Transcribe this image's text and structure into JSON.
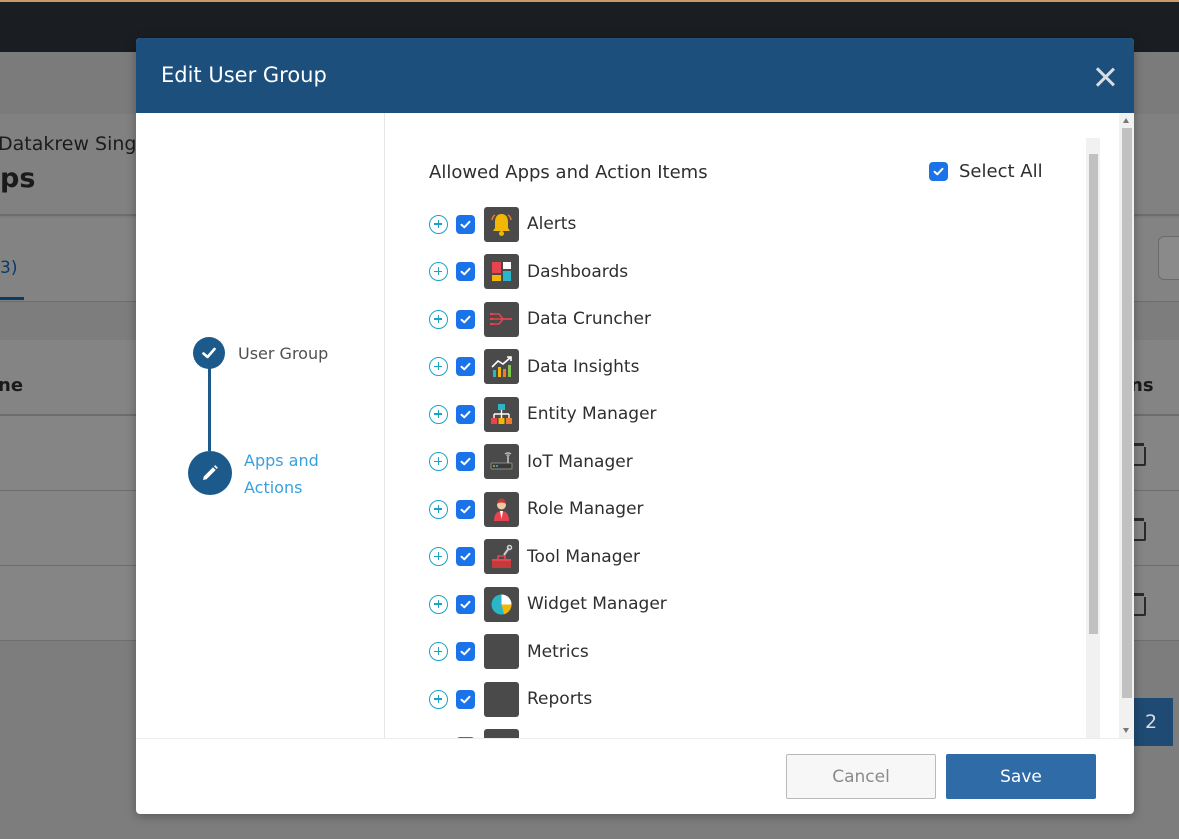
{
  "background": {
    "org_name": "Datakrew Singa",
    "page_title": "ps",
    "tab_count": "3)",
    "col_left": "ne",
    "col_right": "ns",
    "pagination_current": "2"
  },
  "modal": {
    "title": "Edit User Group",
    "close_icon": "close-icon"
  },
  "stepper": {
    "steps": [
      {
        "label": "User Group",
        "status": "completed"
      },
      {
        "label_line1": "Apps and",
        "label_line2": "Actions",
        "status": "active"
      }
    ]
  },
  "content": {
    "title": "Allowed Apps and Action Items",
    "select_all_label": "Select All",
    "select_all_checked": true,
    "apps": [
      {
        "label": "Alerts",
        "icon": "alerts-icon",
        "checked": true
      },
      {
        "label": "Dashboards",
        "icon": "dashboards-icon",
        "checked": true
      },
      {
        "label": "Data Cruncher",
        "icon": "data-cruncher-icon",
        "checked": true
      },
      {
        "label": "Data Insights",
        "icon": "data-insights-icon",
        "checked": true
      },
      {
        "label": "Entity Manager",
        "icon": "entity-manager-icon",
        "checked": true
      },
      {
        "label": "IoT Manager",
        "icon": "iot-manager-icon",
        "checked": true
      },
      {
        "label": "Role Manager",
        "icon": "role-manager-icon",
        "checked": true
      },
      {
        "label": "Tool Manager",
        "icon": "tool-manager-icon",
        "checked": true
      },
      {
        "label": "Widget Manager",
        "icon": "widget-manager-icon",
        "checked": true
      },
      {
        "label": "Metrics",
        "icon": "metrics-icon",
        "checked": true
      },
      {
        "label": "Reports",
        "icon": "reports-icon",
        "checked": true
      }
    ]
  },
  "footer": {
    "cancel_label": "Cancel",
    "save_label": "Save"
  },
  "colors": {
    "header_bg": "#1c4f7c",
    "accent": "#1a73e8",
    "step": "#1c5a8c",
    "active_step_text": "#3aa0dd",
    "save_button": "#2e6ba7",
    "expand_icon": "#1aa3c4"
  }
}
